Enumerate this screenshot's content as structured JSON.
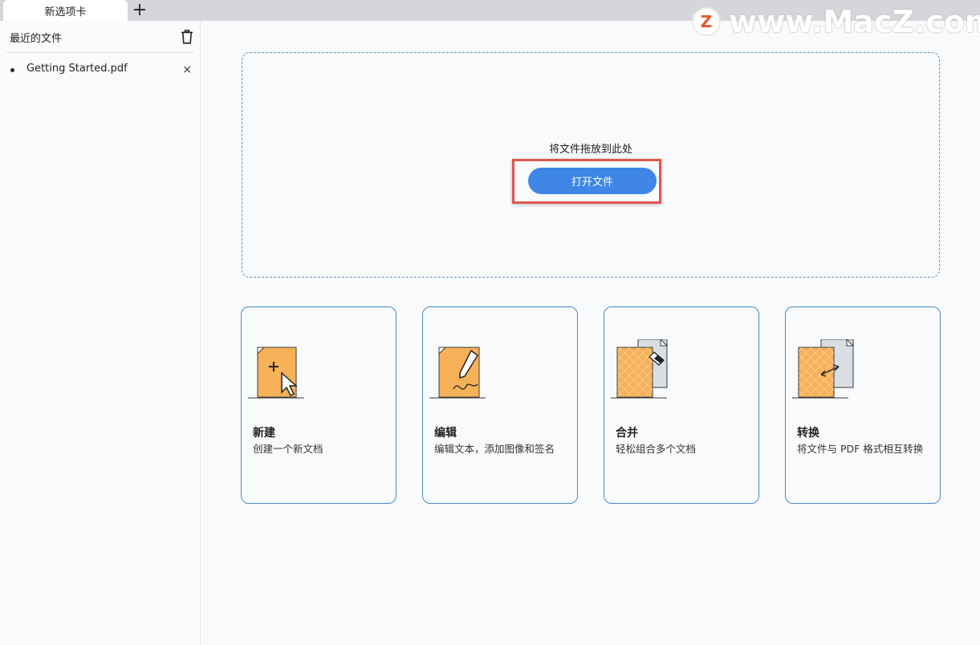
{
  "tabs": [
    {
      "label": "新选项卡"
    }
  ],
  "tab_add_label": "+",
  "watermark": {
    "logo_letter": "Z",
    "text": "www.MacZ.com"
  },
  "sidebar": {
    "title": "最近的文件",
    "files": [
      {
        "name": "Getting Started.pdf",
        "close": "×"
      }
    ]
  },
  "dropzone": {
    "hint": "将文件拖放到此处",
    "open_button": "打开文件"
  },
  "cards": [
    {
      "title": "新建",
      "desc": "创建一个新文档",
      "icon": "new-document-icon"
    },
    {
      "title": "编辑",
      "desc": "编辑文本，添加图像和签名",
      "icon": "edit-document-icon"
    },
    {
      "title": "合并",
      "desc": "轻松组合多个文档",
      "icon": "merge-documents-icon"
    },
    {
      "title": "转换",
      "desc": "将文件与 PDF 格式相互转换",
      "icon": "convert-document-icon"
    }
  ],
  "colors": {
    "accent": "#3f86e6",
    "card_border": "#4f87c2",
    "highlight_box": "#e0574f",
    "doc_orange": "#f7b158"
  }
}
